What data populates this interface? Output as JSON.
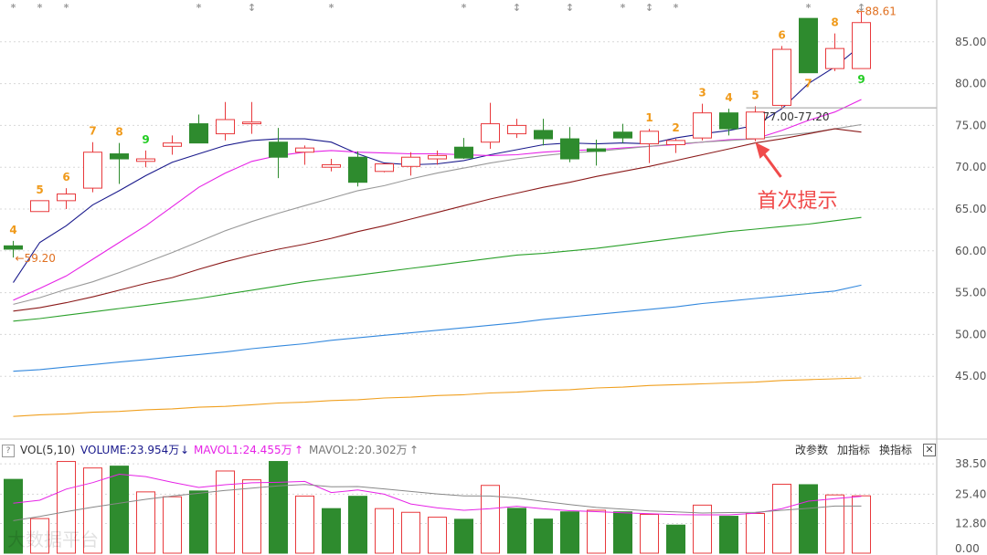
{
  "chart_data": [
    {
      "type": "candlestick",
      "y_ticks": [
        "85.00",
        "80.00",
        "75.00",
        "70.00",
        "65.00",
        "60.00",
        "55.00",
        "50.00",
        "45.00"
      ],
      "y_tick_values": [
        85,
        80,
        75,
        70,
        65,
        60,
        55,
        50,
        45
      ],
      "ylim": [
        37.6,
        90.0
      ],
      "candles": [
        {
          "o": 60.6,
          "h": 61.2,
          "l": 59.2,
          "c": 60.2
        },
        {
          "o": 64.7,
          "h": 66.0,
          "l": 64.7,
          "c": 66.0
        },
        {
          "o": 66.0,
          "h": 67.5,
          "l": 65.0,
          "c": 66.8
        },
        {
          "o": 67.5,
          "h": 73.0,
          "l": 67.0,
          "c": 71.8
        },
        {
          "o": 71.6,
          "h": 72.9,
          "l": 68.0,
          "c": 71.0
        },
        {
          "o": 70.7,
          "h": 72.0,
          "l": 70.0,
          "c": 71.0
        },
        {
          "o": 72.5,
          "h": 73.8,
          "l": 71.5,
          "c": 72.9
        },
        {
          "o": 75.2,
          "h": 76.3,
          "l": 72.9,
          "c": 72.9
        },
        {
          "o": 74.0,
          "h": 77.8,
          "l": 73.2,
          "c": 75.7
        },
        {
          "o": 75.2,
          "h": 77.8,
          "l": 74.0,
          "c": 75.4
        },
        {
          "o": 73.0,
          "h": 74.7,
          "l": 68.7,
          "c": 71.2
        },
        {
          "o": 71.8,
          "h": 72.6,
          "l": 70.3,
          "c": 72.3
        },
        {
          "o": 70.0,
          "h": 71.0,
          "l": 69.5,
          "c": 70.3
        },
        {
          "o": 71.2,
          "h": 71.9,
          "l": 67.7,
          "c": 68.2
        },
        {
          "o": 69.5,
          "h": 70.4,
          "l": 69.4,
          "c": 70.4
        },
        {
          "o": 70.1,
          "h": 71.8,
          "l": 69.0,
          "c": 71.2
        },
        {
          "o": 71.0,
          "h": 72.0,
          "l": 70.3,
          "c": 71.4
        },
        {
          "o": 72.4,
          "h": 73.5,
          "l": 71.0,
          "c": 71.1
        },
        {
          "o": 73.0,
          "h": 77.7,
          "l": 72.2,
          "c": 75.2
        },
        {
          "o": 74.0,
          "h": 75.8,
          "l": 73.5,
          "c": 75.0
        },
        {
          "o": 74.4,
          "h": 75.8,
          "l": 72.6,
          "c": 73.4
        },
        {
          "o": 73.4,
          "h": 74.8,
          "l": 70.6,
          "c": 71.0
        },
        {
          "o": 72.2,
          "h": 73.3,
          "l": 70.2,
          "c": 71.9
        },
        {
          "o": 74.2,
          "h": 75.2,
          "l": 72.9,
          "c": 73.5
        },
        {
          "o": 72.8,
          "h": 74.6,
          "l": 70.5,
          "c": 74.3
        },
        {
          "o": 72.7,
          "h": 73.4,
          "l": 71.7,
          "c": 73.2
        },
        {
          "o": 73.5,
          "h": 77.6,
          "l": 73.2,
          "c": 76.5
        },
        {
          "o": 76.5,
          "h": 77.0,
          "l": 73.8,
          "c": 74.6
        },
        {
          "o": 73.4,
          "h": 77.3,
          "l": 73.1,
          "c": 76.6
        },
        {
          "o": 77.4,
          "h": 84.5,
          "l": 77.0,
          "c": 84.1
        },
        {
          "o": 87.8,
          "h": 87.8,
          "l": 81.3,
          "c": 81.3
        },
        {
          "o": 81.8,
          "h": 86.0,
          "l": 81.5,
          "c": 84.2
        },
        {
          "o": 81.8,
          "h": 88.61,
          "l": 81.8,
          "c": 87.3
        }
      ],
      "ma_lines": [
        {
          "color": "#1a1a8c",
          "values": [
            56.2,
            61.0,
            63.0,
            65.5,
            67.2,
            69.0,
            70.6,
            71.6,
            72.6,
            73.2,
            73.4,
            73.4,
            73.0,
            71.6,
            70.5,
            70.3,
            70.4,
            70.8,
            71.5,
            72.1,
            72.7,
            72.9,
            72.8,
            72.9,
            72.8,
            73.5,
            74.0,
            74.4,
            75.0,
            77.0,
            80.0,
            82.0,
            84.6
          ]
        },
        {
          "color": "#e623e6",
          "values": [
            54.1,
            55.5,
            57.0,
            59.0,
            61.0,
            63.0,
            65.3,
            67.6,
            69.3,
            70.7,
            71.4,
            71.8,
            72.0,
            71.8,
            71.7,
            71.6,
            71.6,
            71.5,
            71.4,
            71.5,
            71.8,
            72.0,
            72.1,
            72.3,
            72.5,
            72.7,
            73.0,
            73.3,
            73.4,
            74.4,
            75.6,
            76.6,
            78.1
          ]
        },
        {
          "color": "#999999",
          "values": [
            53.6,
            54.4,
            55.4,
            56.3,
            57.4,
            58.6,
            59.8,
            61.1,
            62.4,
            63.5,
            64.5,
            65.4,
            66.3,
            67.2,
            67.8,
            68.6,
            69.3,
            69.9,
            70.5,
            71.0,
            71.4,
            71.7,
            71.9,
            72.2,
            72.5,
            72.8,
            73.0,
            73.2,
            73.4,
            73.8,
            74.1,
            74.6,
            75.1
          ]
        },
        {
          "color": "#8b1a1a",
          "values": [
            52.8,
            53.2,
            53.8,
            54.5,
            55.3,
            56.1,
            56.8,
            57.8,
            58.7,
            59.5,
            60.2,
            60.8,
            61.5,
            62.3,
            63.0,
            63.8,
            64.6,
            65.4,
            66.2,
            66.9,
            67.6,
            68.2,
            68.9,
            69.5,
            70.1,
            70.8,
            71.5,
            72.2,
            72.9,
            73.4,
            74.0,
            74.6,
            74.2
          ]
        },
        {
          "color": "#2aa02a",
          "values": [
            51.6,
            51.9,
            52.3,
            52.7,
            53.1,
            53.5,
            53.9,
            54.3,
            54.8,
            55.3,
            55.8,
            56.3,
            56.7,
            57.1,
            57.5,
            57.9,
            58.3,
            58.7,
            59.1,
            59.5,
            59.7,
            60.0,
            60.3,
            60.7,
            61.1,
            61.5,
            61.9,
            62.3,
            62.6,
            62.9,
            63.2,
            63.6,
            64.0
          ]
        },
        {
          "color": "#3388dd",
          "values": [
            45.6,
            45.8,
            46.1,
            46.4,
            46.7,
            47.0,
            47.3,
            47.6,
            47.9,
            48.3,
            48.6,
            48.9,
            49.3,
            49.6,
            49.9,
            50.2,
            50.5,
            50.8,
            51.1,
            51.4,
            51.8,
            52.1,
            52.4,
            52.7,
            53.0,
            53.3,
            53.7,
            54.0,
            54.3,
            54.6,
            54.9,
            55.2,
            55.9
          ]
        },
        {
          "color": "#f0a020",
          "values": [
            40.2,
            40.4,
            40.5,
            40.7,
            40.8,
            41.0,
            41.1,
            41.3,
            41.4,
            41.6,
            41.8,
            41.9,
            42.1,
            42.2,
            42.4,
            42.5,
            42.7,
            42.8,
            43.0,
            43.1,
            43.3,
            43.4,
            43.6,
            43.7,
            43.9,
            44.0,
            44.1,
            44.2,
            44.3,
            44.5,
            44.6,
            44.7,
            44.8
          ]
        }
      ],
      "td_counts": [
        {
          "i": 0,
          "label": "4",
          "color": "#f09a1a",
          "pos": "top"
        },
        {
          "i": 1,
          "label": "5",
          "color": "#f09a1a",
          "pos": "top"
        },
        {
          "i": 2,
          "label": "6",
          "color": "#f09a1a",
          "pos": "top"
        },
        {
          "i": 3,
          "label": "7",
          "color": "#f09a1a",
          "pos": "top"
        },
        {
          "i": 4,
          "label": "8",
          "color": "#f09a1a",
          "pos": "top"
        },
        {
          "i": 5,
          "label": "9",
          "color": "#22cc22",
          "pos": "top"
        },
        {
          "i": 24,
          "label": "1",
          "color": "#f09a1a",
          "pos": "top"
        },
        {
          "i": 25,
          "label": "2",
          "color": "#f09a1a",
          "pos": "top"
        },
        {
          "i": 26,
          "label": "3",
          "color": "#f09a1a",
          "pos": "top"
        },
        {
          "i": 27,
          "label": "4",
          "color": "#f09a1a",
          "pos": "top"
        },
        {
          "i": 28,
          "label": "5",
          "color": "#f09a1a",
          "pos": "top"
        },
        {
          "i": 29,
          "label": "6",
          "color": "#f09a1a",
          "pos": "top"
        },
        {
          "i": 30,
          "label": "7",
          "color": "#f09a1a",
          "pos": "bottom"
        },
        {
          "i": 31,
          "label": "8",
          "color": "#f09a1a",
          "pos": "top"
        },
        {
          "i": 32,
          "label": "9",
          "color": "#22cc22",
          "pos": "bottom"
        }
      ],
      "marks_top": [
        {
          "i": 0,
          "label": "*"
        },
        {
          "i": 1,
          "label": "*"
        },
        {
          "i": 2,
          "label": "*"
        },
        {
          "i": 7,
          "label": "*"
        },
        {
          "i": 9,
          "label": "↕"
        },
        {
          "i": 12,
          "label": "*"
        },
        {
          "i": 17,
          "label": "*"
        },
        {
          "i": 19,
          "label": "↕"
        },
        {
          "i": 21,
          "label": "↕"
        },
        {
          "i": 23,
          "label": "*"
        },
        {
          "i": 24,
          "label": "↕"
        },
        {
          "i": 25,
          "label": "*"
        },
        {
          "i": 30,
          "label": "*"
        },
        {
          "i": 32,
          "label": "↕"
        }
      ],
      "annotations": {
        "low_label": "←59.20",
        "low_value": 59.2,
        "high_label": "←88.61",
        "high_value": 88.61,
        "range_label": "77.00-77.20",
        "range_value": 77.1,
        "range_start_index": 28,
        "first_signal_text": "首次提示",
        "first_signal_index": 28,
        "first_signal_value": 73.2
      },
      "colors": {
        "up": "#e8393c",
        "down": "#2e8b2e",
        "grid": "#d8d8d8",
        "axis_text": "#555555"
      }
    },
    {
      "type": "bar",
      "name": "VOL",
      "y_ticks": [
        "38.50",
        "25.40",
        "12.80",
        "0.00"
      ],
      "y_tick_values": [
        38.5,
        25.4,
        12.8,
        0.0
      ],
      "ylim": [
        0,
        40.5
      ],
      "values": [
        31.8,
        14.9,
        39.5,
        36.7,
        37.5,
        26.4,
        24.3,
        26.8,
        35.4,
        31.6,
        39.5,
        24.6,
        19.2,
        24.5,
        19.2,
        17.6,
        15.5,
        14.6,
        29.2,
        19.3,
        14.7,
        17.8,
        18.5,
        17.8,
        16.7,
        12.1,
        20.7,
        15.9,
        17.1,
        29.7,
        29.5,
        25.1,
        24.7
      ],
      "directions": [
        "down",
        "up",
        "up",
        "up",
        "down",
        "up",
        "up",
        "down",
        "up",
        "up",
        "down",
        "up",
        "down",
        "down",
        "up",
        "up",
        "up",
        "down",
        "up",
        "down",
        "down",
        "down",
        "up",
        "down",
        "up",
        "down",
        "up",
        "down",
        "up",
        "up",
        "down",
        "up",
        "up"
      ],
      "mavol1": [
        21.5,
        22.8,
        27.6,
        30.4,
        34.0,
        33.0,
        30.5,
        28.3,
        29.5,
        30.3,
        30.5,
        30.9,
        26.1,
        27.2,
        25.4,
        21.2,
        19.5,
        18.5,
        19.2,
        20.2,
        19.1,
        18.3,
        17.9,
        17.4,
        17.0,
        16.6,
        16.5,
        16.5,
        17.2,
        19.2,
        22.4,
        23.5,
        24.5
      ],
      "mavol2": [
        14.0,
        15.8,
        17.9,
        19.8,
        21.5,
        23.2,
        24.6,
        25.8,
        27.0,
        28.0,
        29.0,
        29.6,
        28.6,
        28.7,
        27.7,
        26.6,
        25.5,
        24.7,
        24.6,
        23.8,
        22.3,
        20.9,
        19.7,
        19.0,
        18.2,
        17.8,
        17.3,
        17.5,
        17.6,
        18.5,
        19.3,
        20.3,
        20.3
      ]
    }
  ],
  "vol_header": {
    "icon": "?",
    "vol_label": "VOL(5,10)",
    "volume_text": "VOLUME:23.954万",
    "volume_arrow": "↓",
    "mavol1_text": "MAVOL1:24.455万",
    "mavol1_arrow": "↑",
    "mavol2_text": "MAVOL2:20.302万",
    "mavol2_arrow": "↑",
    "btn_change": "改参数",
    "btn_add": "加指标",
    "btn_swap": "换指标",
    "btn_close": "✕",
    "colors": {
      "vol": "#333333",
      "volume": "#1a1a8c",
      "mavol1": "#e623e6",
      "mavol2": "#777777"
    }
  },
  "watermark": "大数据平台"
}
